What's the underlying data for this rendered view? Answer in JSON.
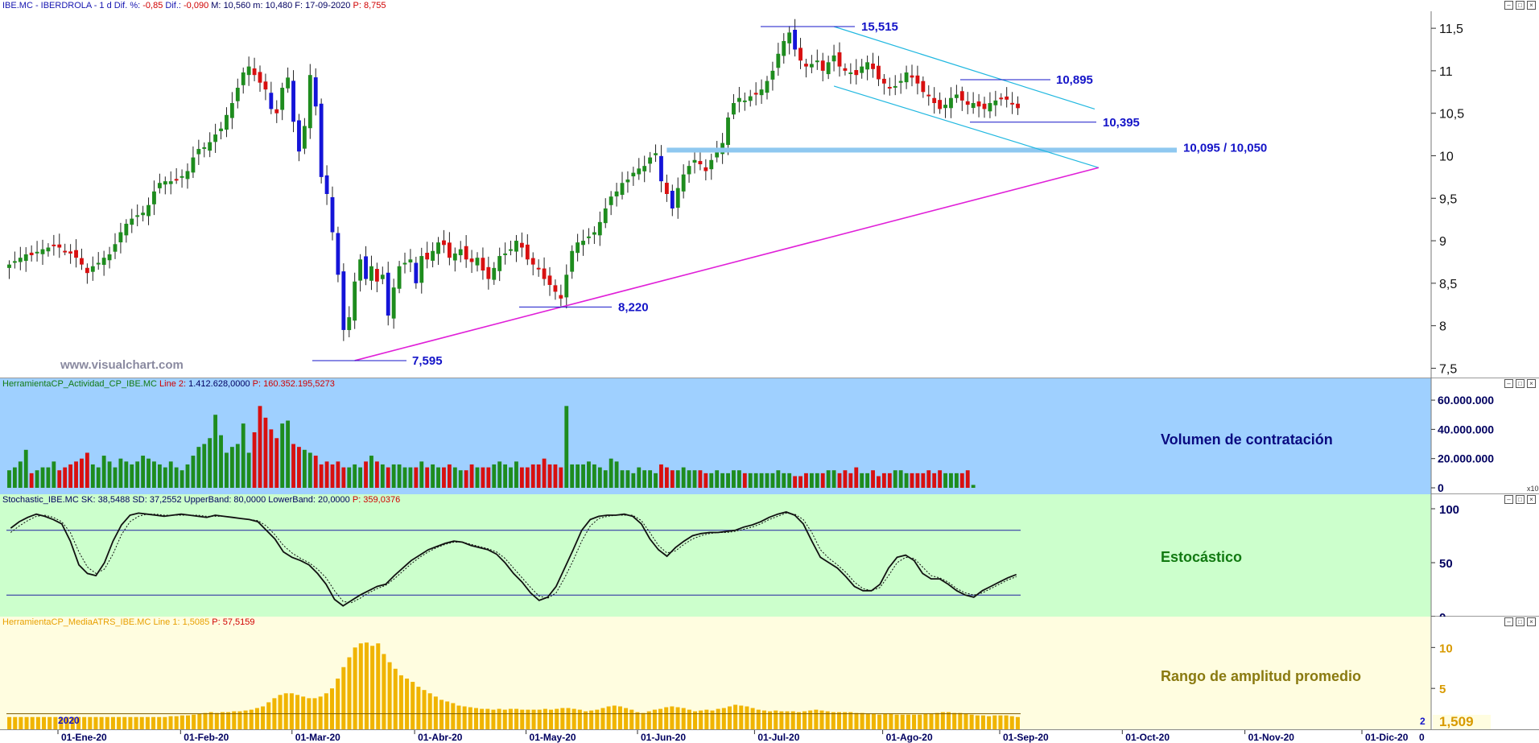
{
  "price_pane": {
    "header": {
      "symbol": "IBE.MC - IBERDROLA - 1 d",
      "diff_pct_label": "Dif. %:",
      "diff_pct": "-0,85",
      "diff_label": "Dif.:",
      "diff": "-0,090",
      "max_label": "M:",
      "max": "10,560",
      "min_label": "m:",
      "min": "10,480",
      "date_label": "F:",
      "date": "17-09-2020",
      "p_label": "P:",
      "p": "8,755"
    },
    "watermark": "www.visualchart.com",
    "annotations": {
      "high": "15,515",
      "resistance": "10,895",
      "support_low": "10,395",
      "zone": "10,095 / 10,050",
      "mid_low": "8,220",
      "low": "7,595"
    }
  },
  "volume_pane": {
    "header": {
      "name": "HerramientaCP_Actividad_CP_IBE.MC",
      "line_label": "Line 2:",
      "line_value": "1.412.628,0000",
      "p_label": "P:",
      "p_value": "160.352.195,5273"
    },
    "title": "Volumen de contratación",
    "axis_ticks": [
      "60.000.000",
      "40.000.000",
      "20.000.000",
      "0"
    ],
    "scale_badge": "x10"
  },
  "stoch_pane": {
    "header": {
      "name": "Stochastic_IBE.MC",
      "sk": "SK: 38,5488",
      "sd": "SD: 37,2552",
      "upper": "UpperBand: 80,0000",
      "lower": "LowerBand: 20,0000",
      "p": "P: 359,0376"
    },
    "title": "Estocástico",
    "axis_ticks": [
      "100",
      "50",
      "0"
    ]
  },
  "atr_pane": {
    "header": {
      "name": "HerramientaCP_MediaATRS_IBE.MC",
      "line": "Line 1: 1,5085",
      "p": "P: 57,5159"
    },
    "title": "Rango de amplitud promedio",
    "axis_ticks": [
      "10",
      "5"
    ],
    "last_value": "1,509",
    "year_marker": "2020",
    "small_marker": "2"
  },
  "x_axis": {
    "labels": [
      "01-Ene-20",
      "01-Feb-20",
      "01-Mar-20",
      "01-Abr-20",
      "01-May-20",
      "01-Jun-20",
      "01-Jul-20",
      "01-Ago-20",
      "01-Sep-20",
      "01-Oct-20",
      "01-Nov-20",
      "01-Dic-20"
    ],
    "end_label": "0"
  },
  "colors": {
    "up_candle": "#1e8c1e",
    "down_candle": "#d81010",
    "blue_candle": "#1414d8",
    "annotation": "#1414c8",
    "channel": "#22b8e0",
    "trendline": "#e020d8",
    "zone": "#8fc8f0",
    "volume_bg": "#9fd0ff",
    "stoch_bg": "#ccffcc",
    "atr_bg": "#fffde0",
    "atr_bar": "#f0b400"
  },
  "chart_data": [
    {
      "type": "candlestick",
      "title": "IBE.MC - IBERDROLA - 1 d",
      "ylim": [
        7.4,
        11.7
      ],
      "y_ticks": [
        "11,5",
        "11",
        "10,5",
        "10",
        "9,5",
        "9",
        "8,5",
        "8",
        "7,5"
      ],
      "y_tick_values": [
        11.5,
        11,
        10.5,
        10,
        9.5,
        9,
        8.5,
        8,
        7.5
      ],
      "x_range": [
        "2020-01-01",
        "2020-12-31"
      ],
      "close": [
        8.72,
        8.76,
        8.8,
        8.84,
        8.83,
        8.87,
        8.9,
        8.92,
        8.94,
        8.92,
        8.88,
        8.85,
        8.8,
        8.72,
        8.62,
        8.7,
        8.74,
        8.8,
        8.84,
        8.96,
        9.1,
        9.2,
        9.26,
        9.3,
        9.33,
        9.42,
        9.58,
        9.68,
        9.7,
        9.7,
        9.72,
        9.76,
        9.82,
        9.98,
        10.08,
        10.1,
        10.16,
        10.25,
        10.32,
        10.48,
        10.62,
        10.8,
        10.98,
        11.05,
        10.95,
        10.86,
        10.78,
        10.55,
        10.5,
        10.8,
        10.92,
        10.4,
        10.05,
        10.35,
        10.95,
        10.58,
        9.75,
        9.55,
        9.1,
        8.6,
        7.95,
        8.1,
        8.52,
        8.78,
        8.55,
        8.7,
        8.52,
        8.6,
        8.12,
        8.45,
        8.7,
        8.74,
        8.78,
        8.5,
        8.82,
        8.78,
        8.88,
        8.98,
        8.95,
        8.8,
        8.85,
        8.9,
        8.78,
        8.75,
        8.8,
        8.65,
        8.55,
        8.68,
        8.82,
        8.85,
        8.9,
        9.0,
        8.92,
        8.78,
        8.72,
        8.68,
        8.55,
        8.48,
        8.4,
        8.32,
        8.6,
        8.88,
        8.98,
        9.0,
        9.05,
        9.1,
        9.22,
        9.38,
        9.52,
        9.58,
        9.68,
        9.72,
        9.8,
        9.85,
        9.88,
        9.98,
        10.03,
        9.7,
        9.55,
        9.38,
        9.62,
        9.78,
        9.88,
        9.95,
        9.9,
        9.82,
        9.95,
        10.05,
        10.15,
        10.45,
        10.62,
        10.68,
        10.65,
        10.7,
        10.72,
        10.78,
        10.88,
        11.0,
        11.2,
        11.35,
        11.45,
        11.25,
        11.12,
        11.05,
        11.08,
        11.12,
        11.0,
        11.1,
        11.18,
        11.05,
        11.0,
        10.98,
        10.95,
        11.05,
        11.1,
        11.02,
        10.9,
        10.85,
        10.8,
        10.82,
        10.88,
        10.98,
        10.92,
        10.85,
        10.75,
        10.7,
        10.62,
        10.55,
        10.6,
        10.68,
        10.72,
        10.65,
        10.6,
        10.62,
        10.58,
        10.55,
        10.62,
        10.65,
        10.68,
        10.66,
        10.62,
        10.56
      ]
    },
    {
      "type": "bar",
      "title": "Volumen de contratación",
      "ylim": [
        0,
        65000000
      ],
      "values": [
        12,
        14,
        18,
        26,
        10,
        12,
        14,
        14,
        18,
        12,
        14,
        16,
        18,
        20,
        24,
        16,
        14,
        22,
        18,
        14,
        20,
        18,
        16,
        18,
        22,
        20,
        18,
        16,
        14,
        18,
        14,
        12,
        16,
        22,
        28,
        30,
        34,
        50,
        36,
        24,
        28,
        30,
        44,
        24,
        38,
        56,
        48,
        40,
        34,
        44,
        46,
        30,
        28,
        26,
        24,
        22,
        16,
        18,
        16,
        18,
        14,
        14,
        16,
        14,
        18,
        22,
        18,
        16,
        14,
        16,
        16,
        14,
        14,
        14,
        18,
        14,
        16,
        14,
        14,
        16,
        14,
        12,
        12,
        16,
        14,
        14,
        14,
        16,
        18,
        16,
        14,
        18,
        14,
        14,
        16,
        16,
        20,
        16,
        16,
        14,
        56,
        16,
        16,
        16,
        18,
        16,
        14,
        12,
        20,
        18,
        12,
        12,
        10,
        14,
        12,
        12,
        10,
        16,
        14,
        12,
        12,
        14,
        12,
        12,
        12,
        10,
        10,
        12,
        10,
        10,
        12,
        12,
        10,
        10,
        10,
        10,
        10,
        10,
        12,
        10,
        10,
        8,
        8,
        10,
        10,
        10,
        10,
        12,
        12,
        10,
        12,
        10,
        14,
        10,
        10,
        12,
        8,
        10,
        10,
        12,
        12,
        10,
        10,
        10,
        10,
        12,
        10,
        12,
        10,
        10,
        10,
        10,
        12,
        2
      ]
    },
    {
      "type": "line",
      "title": "Estocástico",
      "ylim": [
        0,
        100
      ],
      "bands": [
        80,
        20
      ],
      "series": [
        {
          "name": "SK",
          "values": [
            82,
            88,
            92,
            95,
            93,
            90,
            86,
            70,
            48,
            40,
            38,
            50,
            70,
            85,
            94,
            96,
            95,
            94,
            93,
            94,
            95,
            94,
            93,
            92,
            94,
            93,
            92,
            91,
            90,
            88,
            80,
            72,
            60,
            55,
            52,
            48,
            40,
            30,
            16,
            10,
            15,
            20,
            24,
            28,
            30,
            38,
            45,
            52,
            57,
            62,
            65,
            68,
            70,
            69,
            66,
            64,
            62,
            58,
            50,
            40,
            32,
            22,
            15,
            18,
            28,
            45,
            62,
            80,
            90,
            93,
            94,
            94,
            95,
            93,
            86,
            72,
            62,
            56,
            64,
            70,
            75,
            77,
            78,
            78,
            79,
            80,
            83,
            85,
            88,
            92,
            95,
            97,
            94,
            86,
            70,
            55,
            50,
            45,
            37,
            28,
            24,
            24,
            30,
            45,
            55,
            57,
            52,
            40,
            35,
            35,
            30,
            24,
            20,
            18,
            24,
            28,
            32,
            36,
            39
          ]
        },
        {
          "name": "SD",
          "values": [
            78,
            84,
            89,
            93,
            94,
            92,
            88,
            78,
            60,
            46,
            40,
            44,
            58,
            76,
            88,
            93,
            95,
            95,
            94,
            94,
            94,
            94,
            94,
            93,
            93,
            93,
            92,
            91,
            90,
            89,
            84,
            76,
            66,
            59,
            54,
            50,
            44,
            36,
            24,
            14,
            13,
            17,
            22,
            26,
            29,
            35,
            42,
            49,
            55,
            60,
            64,
            67,
            69,
            69,
            67,
            65,
            63,
            60,
            54,
            45,
            36,
            27,
            19,
            17,
            22,
            36,
            52,
            70,
            84,
            91,
            93,
            94,
            94,
            94,
            89,
            78,
            66,
            59,
            61,
            67,
            72,
            75,
            77,
            78,
            78,
            79,
            81,
            83,
            86,
            90,
            93,
            96,
            95,
            90,
            78,
            62,
            54,
            48,
            41,
            32,
            26,
            24,
            27,
            38,
            50,
            55,
            54,
            46,
            38,
            36,
            32,
            26,
            22,
            20,
            22,
            26,
            30,
            34,
            37
          ]
        }
      ]
    },
    {
      "type": "bar",
      "title": "Rango de amplitud promedio",
      "ylim": [
        0,
        12
      ],
      "values": [
        1.5,
        1.5,
        1.5,
        1.5,
        1.5,
        1.5,
        1.5,
        1.5,
        1.5,
        1.5,
        1.5,
        1.5,
        1.5,
        1.5,
        1.5,
        1.5,
        1.5,
        1.5,
        1.5,
        1.5,
        1.5,
        1.5,
        1.5,
        1.5,
        1.5,
        1.5,
        1.5,
        1.5,
        1.6,
        1.6,
        1.7,
        1.7,
        1.8,
        1.9,
        2.0,
        2.1,
        2.0,
        2.1,
        2.1,
        2.2,
        2.2,
        2.3,
        2.4,
        2.6,
        2.8,
        3.3,
        3.8,
        4.2,
        4.4,
        4.4,
        4.2,
        4.0,
        3.8,
        3.8,
        4.0,
        4.4,
        5.0,
        6.2,
        7.6,
        8.8,
        10.0,
        10.5,
        10.6,
        10.2,
        10.5,
        9.2,
        8.2,
        7.4,
        6.6,
        6.2,
        5.8,
        5.2,
        4.8,
        4.4,
        4.0,
        3.6,
        3.4,
        3.2,
        2.9,
        2.8,
        2.7,
        2.6,
        2.5,
        2.5,
        2.4,
        2.5,
        2.4,
        2.5,
        2.5,
        2.4,
        2.4,
        2.4,
        2.4,
        2.5,
        2.4,
        2.5,
        2.6,
        2.6,
        2.5,
        2.4,
        2.2,
        2.3,
        2.4,
        2.6,
        2.8,
        2.9,
        2.8,
        2.6,
        2.4,
        2.1,
        2.0,
        2.2,
        2.4,
        2.5,
        2.7,
        2.8,
        2.7,
        2.6,
        2.4,
        2.2,
        2.3,
        2.4,
        2.3,
        2.5,
        2.6,
        2.8,
        3.0,
        2.9,
        2.8,
        2.6,
        2.4,
        2.3,
        2.2,
        2.3,
        2.2,
        2.2,
        2.2,
        2.1,
        2.2,
        2.3,
        2.4,
        2.3,
        2.2,
        2.1,
        2.1,
        2.1,
        2.1,
        2.0,
        2.0,
        1.9,
        1.9,
        1.8,
        1.9,
        1.9,
        1.8,
        1.8,
        1.8,
        1.8,
        1.8,
        1.9,
        1.9,
        2.0,
        2.1,
        2.1,
        2.0,
        2.0,
        1.9,
        1.8,
        1.7,
        1.7,
        1.6,
        1.7,
        1.7,
        1.7,
        1.6,
        1.5
      ]
    }
  ]
}
